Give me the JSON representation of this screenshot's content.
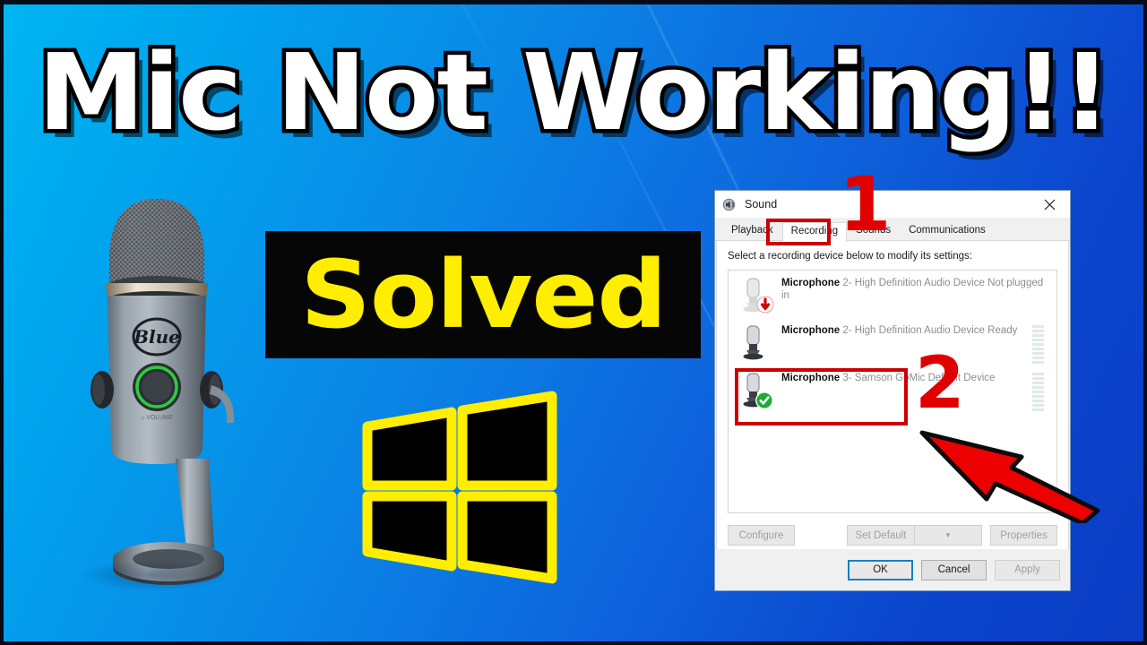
{
  "thumbnail": {
    "headline": "Mic Not Working!!",
    "badge_label": "Solved",
    "brand_on_mic": "Blue",
    "mic_volume_label": "VOLUME",
    "accent_blue_left": "#00b5f2",
    "accent_blue_right": "#0b3cc4",
    "badge_bg": "#060606",
    "badge_text_color": "#ffee00",
    "annotation_red": "#cc0000",
    "windows_logo_outline": "#ffee00",
    "windows_logo_fill": "#000000"
  },
  "annotations": {
    "step_one": "1",
    "step_two": "2"
  },
  "dialog": {
    "title": "Sound",
    "title_icon": "speaker-icon",
    "close_icon": "close-icon",
    "tabs": [
      {
        "label": "Playback",
        "active": false
      },
      {
        "label": "Recording",
        "active": true
      },
      {
        "label": "Sounds",
        "active": false
      },
      {
        "label": "Communications",
        "active": false
      }
    ],
    "prompt": "Select a recording device below to modify its settings:",
    "devices": [
      {
        "name": "Microphone",
        "detail": "2- High Definition Audio Device",
        "status": "Not plugged in",
        "badge": "unplugged",
        "meter_segments": 0
      },
      {
        "name": "Microphone",
        "detail": "2- High Definition Audio Device",
        "status": "Ready",
        "badge": "none",
        "meter_segments": 9
      },
      {
        "name": "Microphone",
        "detail": "3- Samson GoMic",
        "status": "Default Device",
        "badge": "default-check",
        "meter_segments": 9
      }
    ],
    "buttons": {
      "configure": "Configure",
      "set_default": "Set Default",
      "set_default_arrow": "▼",
      "properties": "Properties"
    },
    "footer": {
      "ok": "OK",
      "cancel": "Cancel",
      "apply": "Apply"
    }
  }
}
